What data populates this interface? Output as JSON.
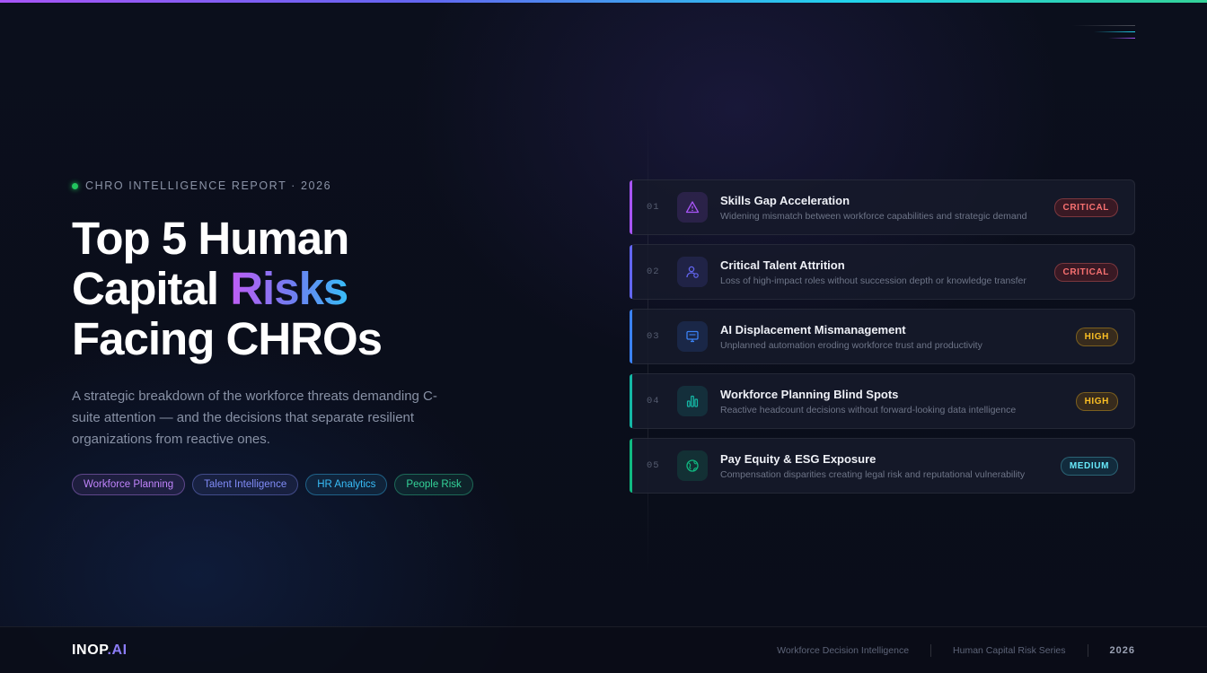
{
  "eyebrow": "CHRO INTELLIGENCE REPORT · 2026",
  "headline": {
    "line1": "Top 5 Human",
    "line2_prefix": "Capital ",
    "line2_accent": "Risks",
    "line3": "Facing CHROs"
  },
  "description": "A strategic breakdown of the workforce threats demanding C-suite attention — and the decisions that separate resilient organizations from reactive ones.",
  "tags": [
    {
      "label": "Workforce Planning",
      "color": "#c084fc"
    },
    {
      "label": "Talent Intelligence",
      "color": "#818cf8"
    },
    {
      "label": "HR Analytics",
      "color": "#38bdf8"
    },
    {
      "label": "People Risk",
      "color": "#34d399"
    }
  ],
  "risks": [
    {
      "num": "01",
      "title": "Skills Gap Acceleration",
      "desc": "Widening mismatch between workforce capabilities and strategic demand",
      "level": "CRITICAL",
      "accent": "#a855f7",
      "icon": "warning-triangle-icon"
    },
    {
      "num": "02",
      "title": "Critical Talent Attrition",
      "desc": "Loss of high-impact roles without succession depth or knowledge transfer",
      "level": "CRITICAL",
      "accent": "#6366f1",
      "icon": "person-exit-icon"
    },
    {
      "num": "03",
      "title": "AI Displacement Mismanagement",
      "desc": "Unplanned automation eroding workforce trust and productivity",
      "level": "HIGH",
      "accent": "#3b82f6",
      "icon": "monitor-icon"
    },
    {
      "num": "04",
      "title": "Workforce Planning Blind Spots",
      "desc": "Reactive headcount decisions without forward-looking data intelligence",
      "level": "HIGH",
      "accent": "#14b8a6",
      "icon": "bar-chart-icon"
    },
    {
      "num": "05",
      "title": "Pay Equity & ESG Exposure",
      "desc": "Compensation disparities creating legal risk and reputational vulnerability",
      "level": "MEDIUM",
      "accent": "#10b981",
      "icon": "globe-icon"
    }
  ],
  "footer": {
    "brand_main": "INOP",
    "brand_suffix": ".AI",
    "item1": "Workforce Decision Intelligence",
    "item2": "Human Capital Risk Series",
    "year": "2026"
  }
}
